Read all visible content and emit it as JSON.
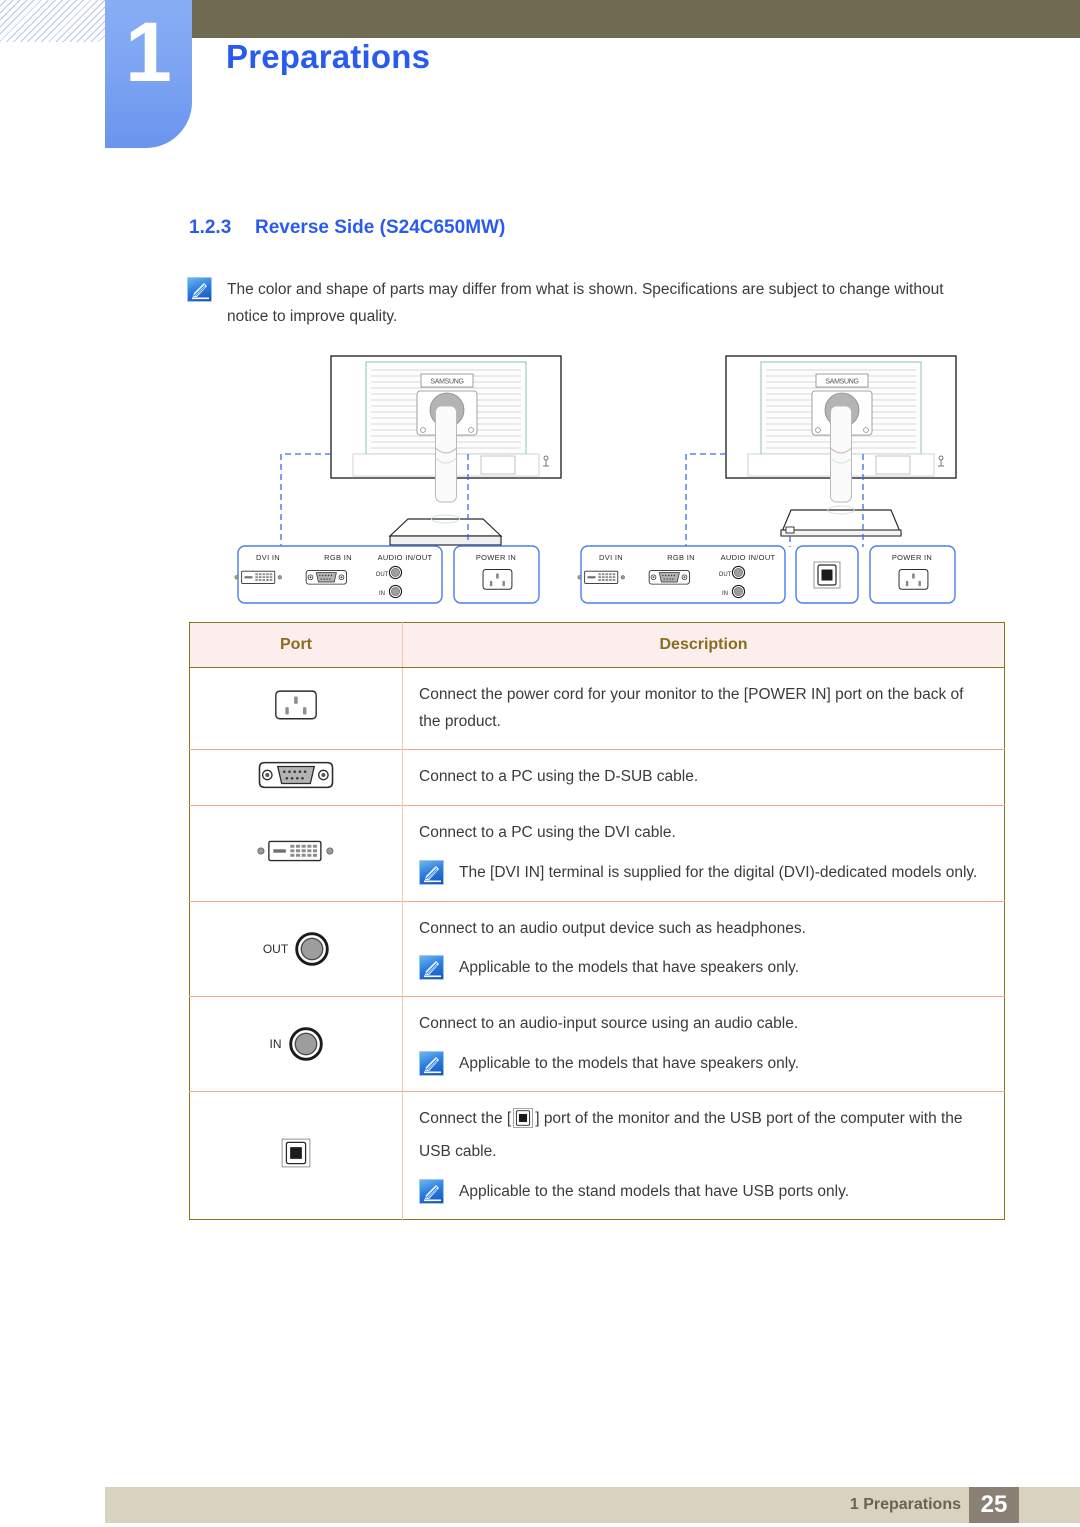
{
  "header": {
    "chapter_number": "1",
    "chapter_title": "Preparations"
  },
  "section": {
    "number": "1.2.3",
    "title": "Reverse Side (S24C650MW)"
  },
  "top_note": {
    "icon": "note-quill-icon",
    "text": "The color and shape of parts may differ from what is shown. Specifications are subject to change without notice to improve quality."
  },
  "diagram": {
    "left_model": {
      "brand_label": "SAMSUNG",
      "panels": [
        {
          "name": "io-panel",
          "ports": [
            {
              "label": "DVI IN",
              "icon": "dvi-port-icon"
            },
            {
              "label": "RGB IN",
              "icon": "dsub-port-icon"
            },
            {
              "label": "AUDIO IN/OUT",
              "icon": "audio-jack-icon",
              "sub_labels": [
                "OUT",
                "IN"
              ]
            }
          ]
        },
        {
          "name": "power-panel",
          "ports": [
            {
              "label": "POWER IN",
              "icon": "power-in-icon"
            }
          ]
        }
      ]
    },
    "right_model": {
      "brand_label": "SAMSUNG",
      "panels": [
        {
          "name": "io-panel",
          "ports": [
            {
              "label": "DVI IN",
              "icon": "dvi-port-icon"
            },
            {
              "label": "RGB IN",
              "icon": "dsub-port-icon"
            },
            {
              "label": "AUDIO IN/OUT",
              "icon": "audio-jack-icon",
              "sub_labels": [
                "OUT",
                "IN"
              ]
            }
          ]
        },
        {
          "name": "usb-panel",
          "ports": [
            {
              "label": "",
              "icon": "usb-b-port-icon"
            }
          ]
        },
        {
          "name": "power-panel",
          "ports": [
            {
              "label": "POWER IN",
              "icon": "power-in-icon"
            }
          ]
        }
      ]
    }
  },
  "table": {
    "headers": {
      "port": "Port",
      "description": "Description"
    },
    "rows": [
      {
        "icon": "power-in-port-icon",
        "icon_label": "",
        "description": "Connect the power cord for your monitor to the [POWER IN] port on the back of the product.",
        "note": null
      },
      {
        "icon": "dsub-port-icon",
        "icon_label": "",
        "description": "Connect to a PC using the D-SUB cable.",
        "note": null
      },
      {
        "icon": "dvi-port-icon",
        "icon_label": "",
        "description": "Connect to a PC using the DVI cable.",
        "note": "The [DVI IN] terminal is supplied for the digital (DVI)-dedicated models only."
      },
      {
        "icon": "audio-out-jack-icon",
        "icon_label": "OUT",
        "description": "Connect to an audio output device such as headphones.",
        "note": "Applicable to the models that have speakers only."
      },
      {
        "icon": "audio-in-jack-icon",
        "icon_label": "IN",
        "description": "Connect to an audio-input source using an audio cable.",
        "note": "Applicable to the models that have speakers only."
      },
      {
        "icon": "usb-b-port-icon",
        "icon_label": "",
        "description_pre": "Connect the [",
        "description_post": "] port of the monitor and the USB port of the computer with the USB cable.",
        "note": "Applicable to the stand models that have USB ports only."
      }
    ]
  },
  "footer": {
    "label": "1 Preparations",
    "page": "25"
  },
  "colors": {
    "chapter_blue": "#2a5bf0",
    "tab_blue": "#7da5f2",
    "olive": "#6f6b52",
    "table_header_bg": "#fbeeed",
    "table_header_text": "#8a6d1e",
    "table_border": "#8a7418",
    "row_divider": "#f0a98f",
    "footer_bar": "#d8d2bf",
    "footer_page_bg": "#8b8074",
    "footer_text": "#6b6352"
  }
}
